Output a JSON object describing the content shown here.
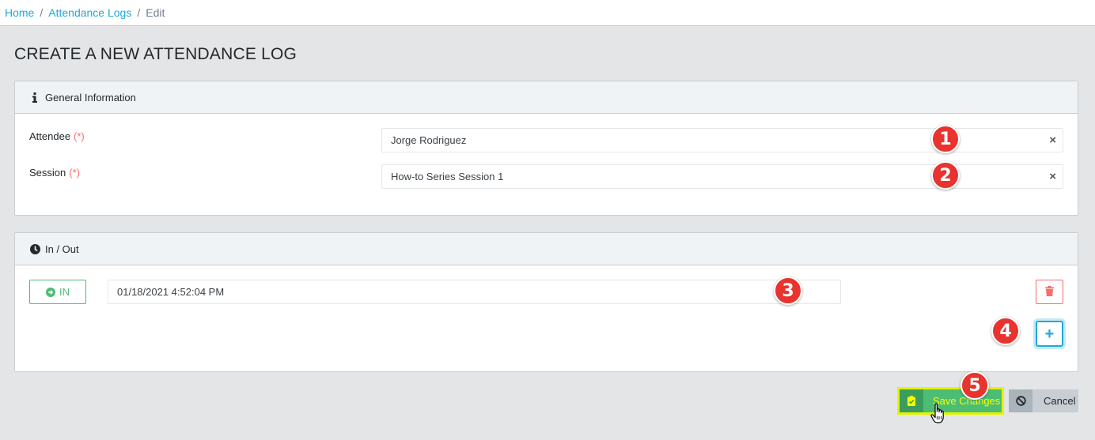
{
  "breadcrumb": {
    "home": "Home",
    "logs": "Attendance Logs",
    "current": "Edit",
    "separator": "/"
  },
  "page": {
    "title": "CREATE A NEW ATTENDANCE LOG"
  },
  "general": {
    "header": "General Information",
    "header_icon": "info-icon",
    "attendee": {
      "label": "Attendee",
      "required": "(*)",
      "value": "Jorge Rodriguez",
      "clear": "×"
    },
    "session": {
      "label": "Session",
      "required": "(*)",
      "value": "How-to Series Session 1",
      "clear": "×"
    }
  },
  "inout": {
    "header": "In / Out",
    "header_icon": "clock-icon",
    "entries": [
      {
        "type": "IN",
        "icon": "arrow-circle-right-icon",
        "datetime": "01/18/2021 4:52:04 PM"
      }
    ],
    "delete_icon": "trash-icon",
    "add_label": "+"
  },
  "actions": {
    "save_label": "Save Changes",
    "save_icon": "clipboard-check-icon",
    "cancel_label": "Cancel",
    "cancel_icon": "ban-icon"
  },
  "annotations": [
    "1",
    "2",
    "3",
    "4",
    "5"
  ],
  "colors": {
    "accent": "#20a8d8",
    "success": "#4dbd74",
    "danger": "#f86c6b",
    "annotation": "#e8332e",
    "highlight": "#e6f200"
  }
}
